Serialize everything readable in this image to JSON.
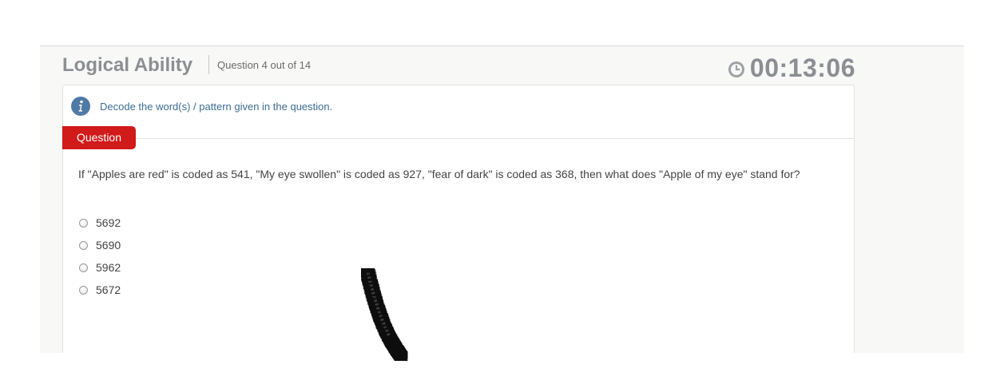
{
  "header": {
    "title": "Logical Ability",
    "question_count": "Question 4 out of 14",
    "timer": "00:13:06"
  },
  "instruction": {
    "icon": "info-icon",
    "text": "Decode the word(s) / pattern given in the question."
  },
  "tab": {
    "label": "Question"
  },
  "question": {
    "text": "If \"Apples are red\" is coded as 541, \"My eye swollen\" is coded as 927, \"fear of dark\" is coded as 368, then what does \"Apple of my eye\" stand for?"
  },
  "options": [
    {
      "label": "5692"
    },
    {
      "label": "5690"
    },
    {
      "label": "5962"
    },
    {
      "label": "5672"
    }
  ],
  "colors": {
    "accent_red": "#d11a1a",
    "info_blue": "#3d6d93",
    "title_gray": "#8b8e92"
  }
}
